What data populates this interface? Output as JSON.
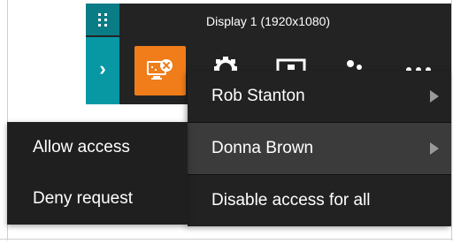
{
  "toolbar": {
    "display_title": "Display 1 (1920x1080)",
    "drag_icon": "drag-grip-icon",
    "expand_icon": "chevron-right-icon",
    "remote_control_icon": "monitor-x-icon",
    "icons": [
      "gear-icon",
      "screen-icon",
      "users-icon",
      "more-icon"
    ]
  },
  "colors": {
    "toolbar_bg": "#232323",
    "rail_top": "#0a7c86",
    "rail_bottom": "#0898a4",
    "accent_orange": "#f07d1a",
    "menu_bg": "#222222",
    "menu_hover": "#3b3b3b"
  },
  "submenu": {
    "items": [
      {
        "label": "Rob Stanton",
        "has_submenu": true
      },
      {
        "label": "Donna Brown",
        "has_submenu": true,
        "highlighted": true
      },
      {
        "label": "Disable access for all",
        "has_submenu": false
      }
    ]
  },
  "context_menu": {
    "items": [
      {
        "label": "Allow access"
      },
      {
        "label": "Deny request"
      }
    ]
  }
}
